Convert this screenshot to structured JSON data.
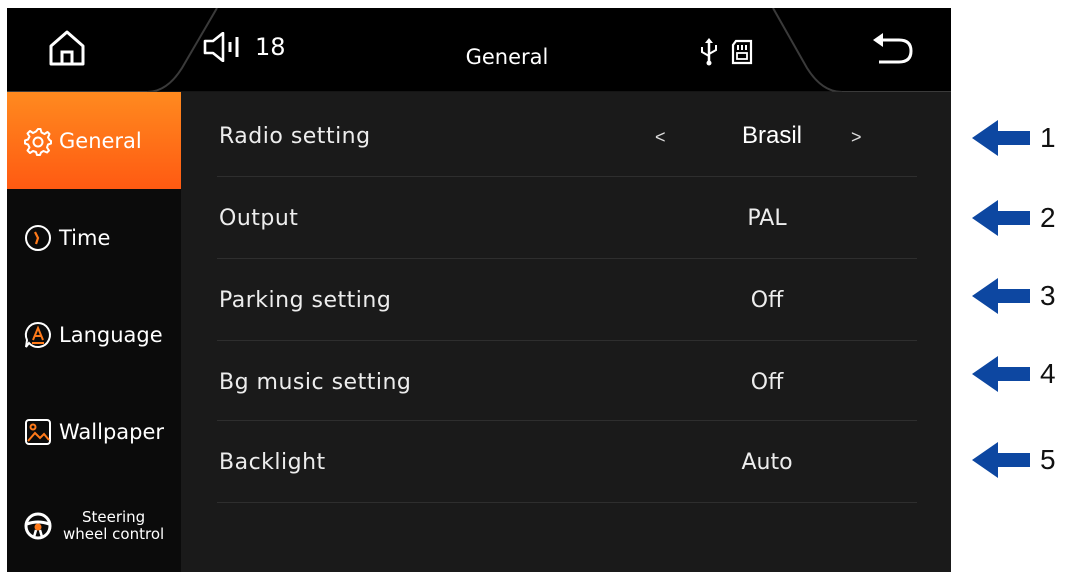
{
  "topbar": {
    "title": "General",
    "volume_level": "18",
    "icons": [
      "home-icon",
      "speaker-icon",
      "usb-icon",
      "sd-card-icon",
      "back-icon"
    ]
  },
  "sidebar": {
    "items": [
      {
        "label": "General",
        "icon": "gear-icon",
        "active": true
      },
      {
        "label": "Time",
        "icon": "clock-icon"
      },
      {
        "label": "Language",
        "icon": "language-icon"
      },
      {
        "label": "Wallpaper",
        "icon": "wallpaper-icon"
      },
      {
        "label_line1": "Steering",
        "label_line2": "wheel control",
        "icon": "steering-wheel-icon"
      }
    ]
  },
  "settings": [
    {
      "label": "Radio setting",
      "value": "Brasil",
      "prev": "<",
      "next": ">"
    },
    {
      "label": "Output",
      "value": "PAL"
    },
    {
      "label": "Parking setting",
      "value": "Off"
    },
    {
      "label": "Bg music setting",
      "value": "Off"
    },
    {
      "label": "Backlight",
      "value": "Auto"
    }
  ],
  "annotations": [
    "1",
    "2",
    "3",
    "4",
    "5"
  ],
  "colors": {
    "accent": "#ff6a16",
    "annotation_arrow": "#0d47a1"
  }
}
